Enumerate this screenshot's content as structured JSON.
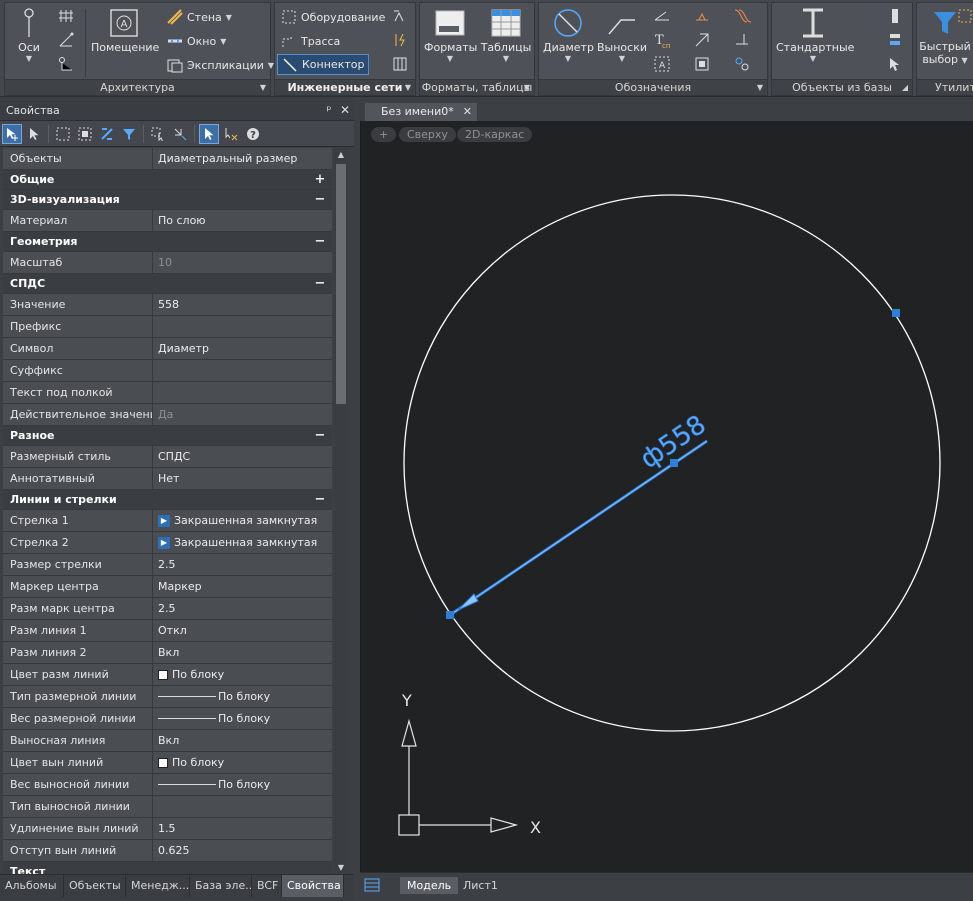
{
  "ribbon": {
    "architecture": {
      "title": "Архитектура",
      "axes_label": "Оси",
      "room_label": "Помещение",
      "wall_label": "Стена",
      "window_label": "Окно",
      "explication_label": "Экспликации"
    },
    "engineering": {
      "title": "Инженерные сети",
      "equipment_label": "Оборудование",
      "route_label": "Трасса",
      "connector_label": "Коннектор"
    },
    "formats": {
      "title": "Форматы, таблицы",
      "formats_label": "Форматы",
      "tables_label": "Таблицы"
    },
    "notations": {
      "title": "Обозначения",
      "diameter_label": "Диаметр",
      "leaders_label": "Выноски"
    },
    "base_objects": {
      "title": "Объекты из базы",
      "standard_label": "Стандартные"
    },
    "utilities": {
      "title": "Утилит",
      "quick_select_label_1": "Быстрый",
      "quick_select_label_2": "выбор"
    }
  },
  "properties": {
    "title": "Свойства",
    "pin": "ᵖ",
    "close": "✕",
    "rows": [
      {
        "type": "prop",
        "key": "Объекты",
        "value": "Диаметральный размер"
      },
      {
        "type": "cat",
        "key": "Общие",
        "toggle": "+"
      },
      {
        "type": "cat",
        "key": "3D-визуализация",
        "toggle": "−"
      },
      {
        "type": "prop",
        "key": "Материал",
        "value": "По слою"
      },
      {
        "type": "cat",
        "key": "Геометрия",
        "toggle": "−"
      },
      {
        "type": "prop",
        "key": "Масштаб",
        "value": "10",
        "dim": true
      },
      {
        "type": "cat",
        "key": "СПДС",
        "toggle": "−"
      },
      {
        "type": "prop",
        "key": "Значение",
        "value": "558"
      },
      {
        "type": "prop",
        "key": "Префикс",
        "value": ""
      },
      {
        "type": "prop",
        "key": "Символ",
        "value": "Диаметр"
      },
      {
        "type": "prop",
        "key": "Суффикс",
        "value": ""
      },
      {
        "type": "prop",
        "key": "Текст под полкой",
        "value": ""
      },
      {
        "type": "prop",
        "key": "Действительное значение",
        "value": "Да",
        "dim": true
      },
      {
        "type": "cat",
        "key": "Разное",
        "toggle": "−"
      },
      {
        "type": "prop",
        "key": "Размерный стиль",
        "value": "СПДС"
      },
      {
        "type": "prop",
        "key": "Аннотативный",
        "value": "Нет"
      },
      {
        "type": "cat",
        "key": "Линии и стрелки",
        "toggle": "−"
      },
      {
        "type": "prop",
        "key": "Стрелка 1",
        "value": "Закрашенная замкнутая",
        "icon": "arrow"
      },
      {
        "type": "prop",
        "key": "Стрелка 2",
        "value": "Закрашенная замкнутая",
        "icon": "arrow"
      },
      {
        "type": "prop",
        "key": "Размер стрелки",
        "value": "2.5"
      },
      {
        "type": "prop",
        "key": "Маркер центра",
        "value": "Маркер"
      },
      {
        "type": "prop",
        "key": "Разм марк центра",
        "value": "2.5"
      },
      {
        "type": "prop",
        "key": "Разм линия 1",
        "value": "Откл"
      },
      {
        "type": "prop",
        "key": "Разм линия 2",
        "value": "Вкл"
      },
      {
        "type": "prop",
        "key": "Цвет разм линий",
        "value": "По блоку",
        "icon": "swatch"
      },
      {
        "type": "prop",
        "key": "Тип размерной линии",
        "value": "По блоку",
        "icon": "line"
      },
      {
        "type": "prop",
        "key": "Вес размерной линии",
        "value": "По блоку",
        "icon": "line"
      },
      {
        "type": "prop",
        "key": "Выносная линия",
        "value": "Вкл"
      },
      {
        "type": "prop",
        "key": "Цвет вын линий",
        "value": "По блоку",
        "icon": "swatch"
      },
      {
        "type": "prop",
        "key": "Вес выносной линии",
        "value": "По блоку",
        "icon": "line"
      },
      {
        "type": "prop",
        "key": "Тип выносной линии",
        "value": ""
      },
      {
        "type": "prop",
        "key": "Удлинение вын линий",
        "value": "1.5"
      },
      {
        "type": "prop",
        "key": "Отступ вын линий",
        "value": "0.625"
      },
      {
        "type": "cat",
        "key": "Текст",
        "toggle": ""
      }
    ]
  },
  "bottom_tabs": [
    "Альбомы",
    "Объекты",
    "Менедж...",
    "База эле...",
    "BCF",
    "Свойства"
  ],
  "document": {
    "tab_title": "Без имени0*",
    "view_plus": "+",
    "view_top": "Сверху",
    "view_mode": "2D-каркас",
    "dimension_text": "ф558",
    "axis_x": "X",
    "axis_y": "Y"
  },
  "layout_tabs": [
    "Модель",
    "Лист1"
  ],
  "colors": {
    "selection": "#2e7fd9",
    "canvas": "#212224",
    "circle": "#ffffff"
  }
}
